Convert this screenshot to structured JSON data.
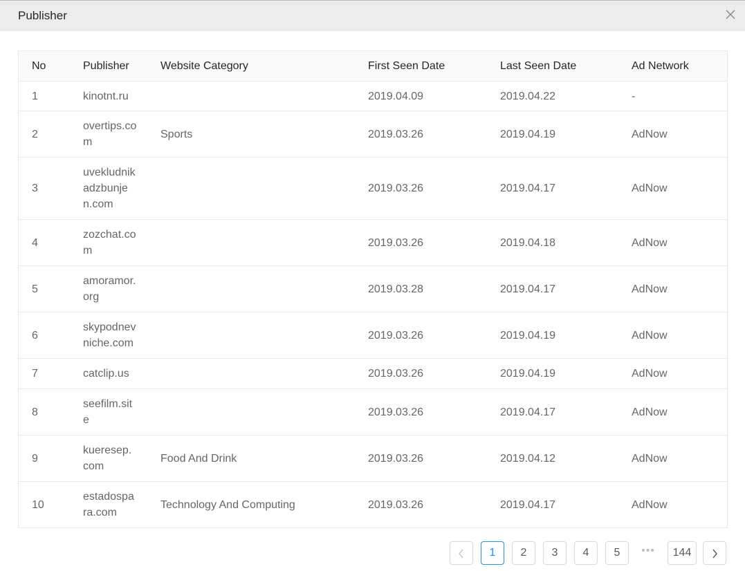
{
  "modal": {
    "title": "Publisher"
  },
  "table": {
    "columns": [
      "No",
      "Publisher",
      "Website Category",
      "First Seen Date",
      "Last Seen Date",
      "Ad Network"
    ],
    "rows": [
      {
        "no": "1",
        "publisher": "kinotnt.ru",
        "category": "",
        "first": "2019.04.09",
        "last": "2019.04.22",
        "network": "-"
      },
      {
        "no": "2",
        "publisher": "overtips.com",
        "category": "Sports",
        "first": "2019.03.26",
        "last": "2019.04.19",
        "network": "AdNow"
      },
      {
        "no": "3",
        "publisher": "uvekludnikadzbunjen.com",
        "category": "",
        "first": "2019.03.26",
        "last": "2019.04.17",
        "network": "AdNow"
      },
      {
        "no": "4",
        "publisher": "zozchat.com",
        "category": "",
        "first": "2019.03.26",
        "last": "2019.04.18",
        "network": "AdNow"
      },
      {
        "no": "5",
        "publisher": "amoramor.org",
        "category": "",
        "first": "2019.03.28",
        "last": "2019.04.17",
        "network": "AdNow"
      },
      {
        "no": "6",
        "publisher": "skypodnevniche.com",
        "category": "",
        "first": "2019.03.26",
        "last": "2019.04.19",
        "network": "AdNow"
      },
      {
        "no": "7",
        "publisher": "catclip.us",
        "category": "",
        "first": "2019.03.26",
        "last": "2019.04.19",
        "network": "AdNow"
      },
      {
        "no": "8",
        "publisher": "seefilm.site",
        "category": "",
        "first": "2019.03.26",
        "last": "2019.04.17",
        "network": "AdNow"
      },
      {
        "no": "9",
        "publisher": "kueresep.com",
        "category": "Food And Drink",
        "first": "2019.03.26",
        "last": "2019.04.12",
        "network": "AdNow"
      },
      {
        "no": "10",
        "publisher": "estadospara.com",
        "category": "Technology And Computing",
        "first": "2019.03.26",
        "last": "2019.04.17",
        "network": "AdNow"
      }
    ]
  },
  "pagination": {
    "prev_icon": "chevron-left-icon",
    "next_icon": "chevron-right-icon",
    "pages": [
      "1",
      "2",
      "3",
      "4",
      "5"
    ],
    "ellipsis": "•••",
    "last_page": "144",
    "current": "1"
  },
  "colors": {
    "accent": "#1890ff",
    "header_bg": "#ececec",
    "border": "#e8e8e8"
  }
}
